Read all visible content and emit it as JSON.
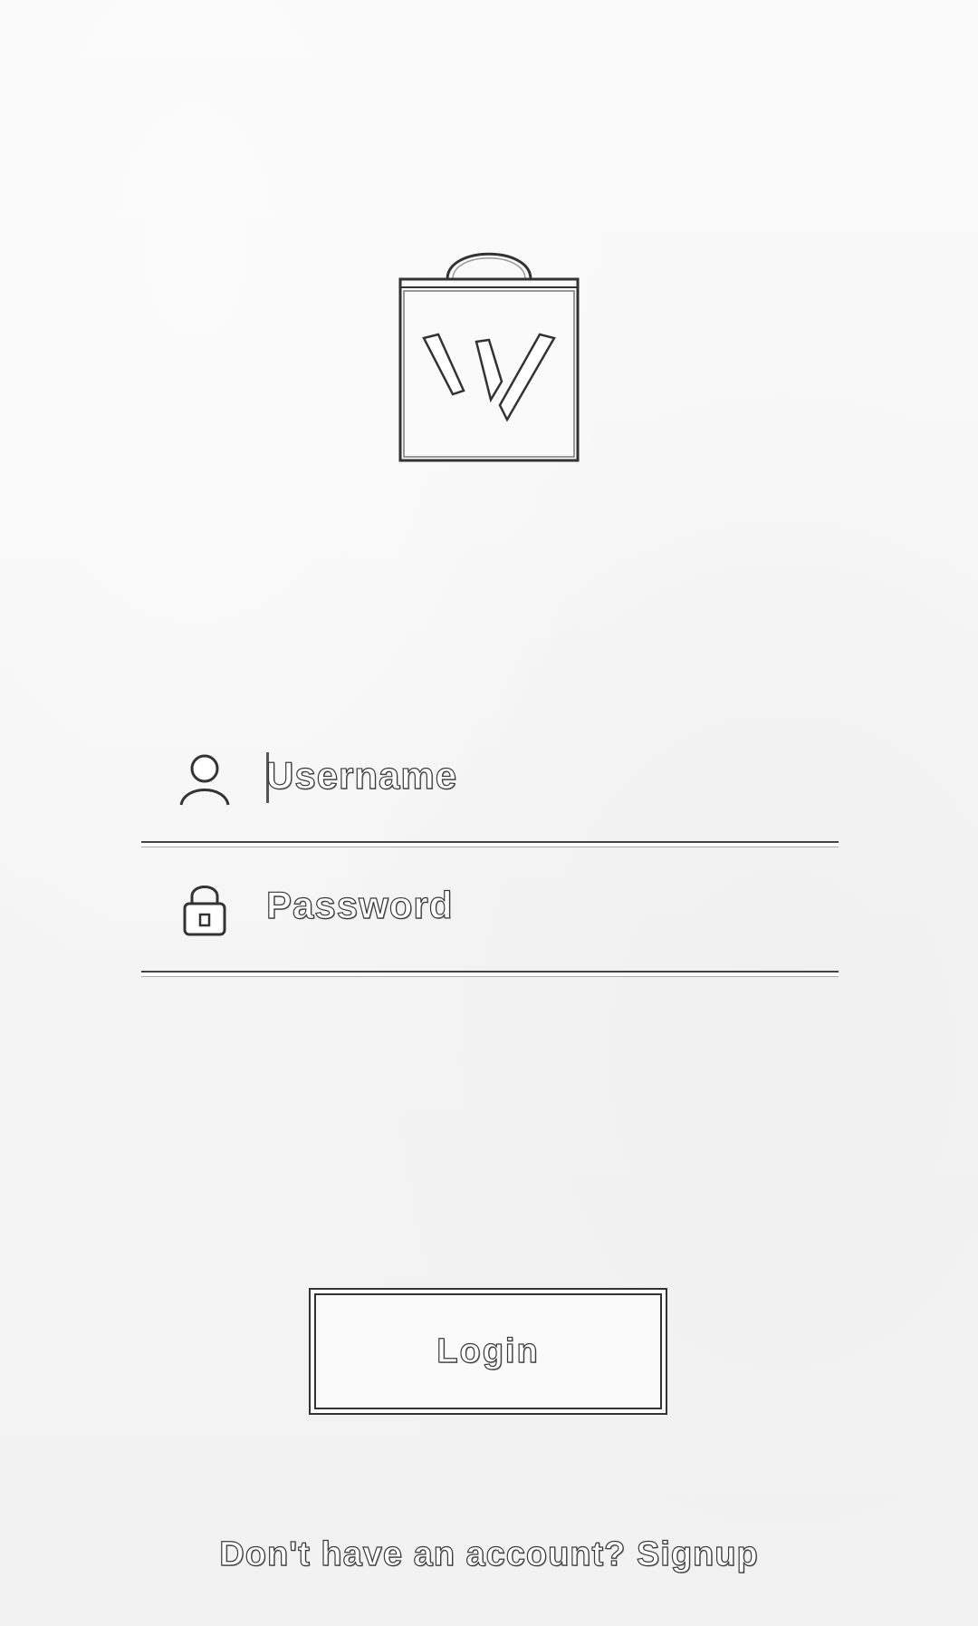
{
  "logo": {
    "icon": "shopping-bag-w-icon"
  },
  "form": {
    "username": {
      "icon": "user-icon",
      "placeholder": "Username"
    },
    "password": {
      "icon": "lock-icon",
      "placeholder": "Password"
    }
  },
  "actions": {
    "login_label": "Login",
    "signup_text": "Don't have an account? Signup"
  }
}
